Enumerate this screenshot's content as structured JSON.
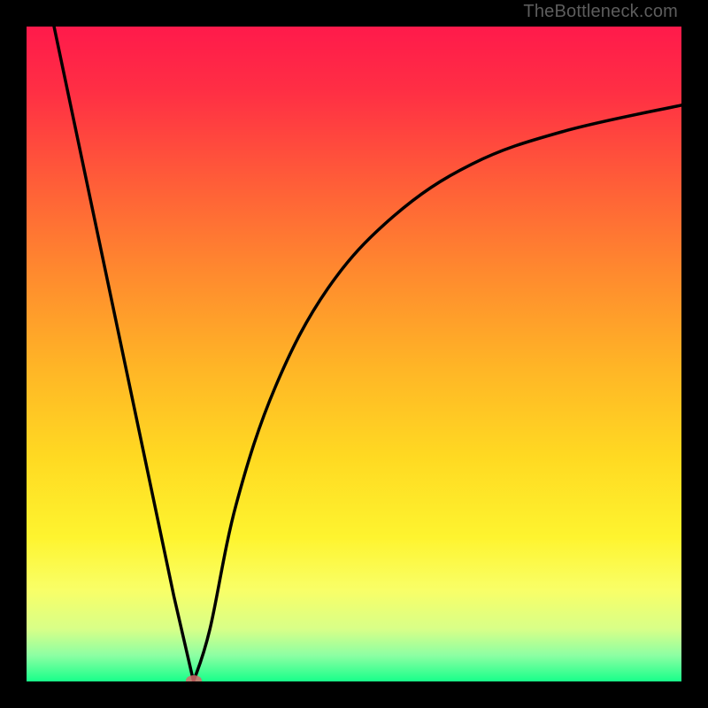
{
  "watermark": "TheBottleneck.com",
  "chart_data": {
    "type": "line",
    "title": "",
    "xlabel": "",
    "ylabel": "",
    "xlim": [
      0,
      100
    ],
    "ylim": [
      0,
      100
    ],
    "grid": false,
    "legend": false,
    "background": {
      "gradient_stops": [
        {
          "pct": 0,
          "color": "#ff1a4b"
        },
        {
          "pct": 10,
          "color": "#ff2f44"
        },
        {
          "pct": 24,
          "color": "#ff5e38"
        },
        {
          "pct": 38,
          "color": "#ff8b2e"
        },
        {
          "pct": 52,
          "color": "#ffb526"
        },
        {
          "pct": 66,
          "color": "#ffda22"
        },
        {
          "pct": 78,
          "color": "#fef42f"
        },
        {
          "pct": 86,
          "color": "#f9ff67"
        },
        {
          "pct": 92,
          "color": "#d8ff88"
        },
        {
          "pct": 96,
          "color": "#8dffa3"
        },
        {
          "pct": 100,
          "color": "#18ff8a"
        }
      ]
    },
    "series": [
      {
        "name": "bottleneck-curve",
        "color": "#000000",
        "points": [
          {
            "x": 4.2,
            "y": 100
          },
          {
            "x": 22.5,
            "y": 13
          },
          {
            "x": 25.5,
            "y": 0
          },
          {
            "x": 28,
            "y": 8
          },
          {
            "x": 32,
            "y": 27
          },
          {
            "x": 38,
            "y": 45
          },
          {
            "x": 46,
            "y": 60
          },
          {
            "x": 56,
            "y": 71
          },
          {
            "x": 68,
            "y": 79
          },
          {
            "x": 82,
            "y": 84
          },
          {
            "x": 100,
            "y": 88
          }
        ]
      }
    ],
    "markers": [
      {
        "name": "min-point",
        "x": 25.5,
        "y": 0,
        "color": "#d46a6a"
      }
    ]
  }
}
